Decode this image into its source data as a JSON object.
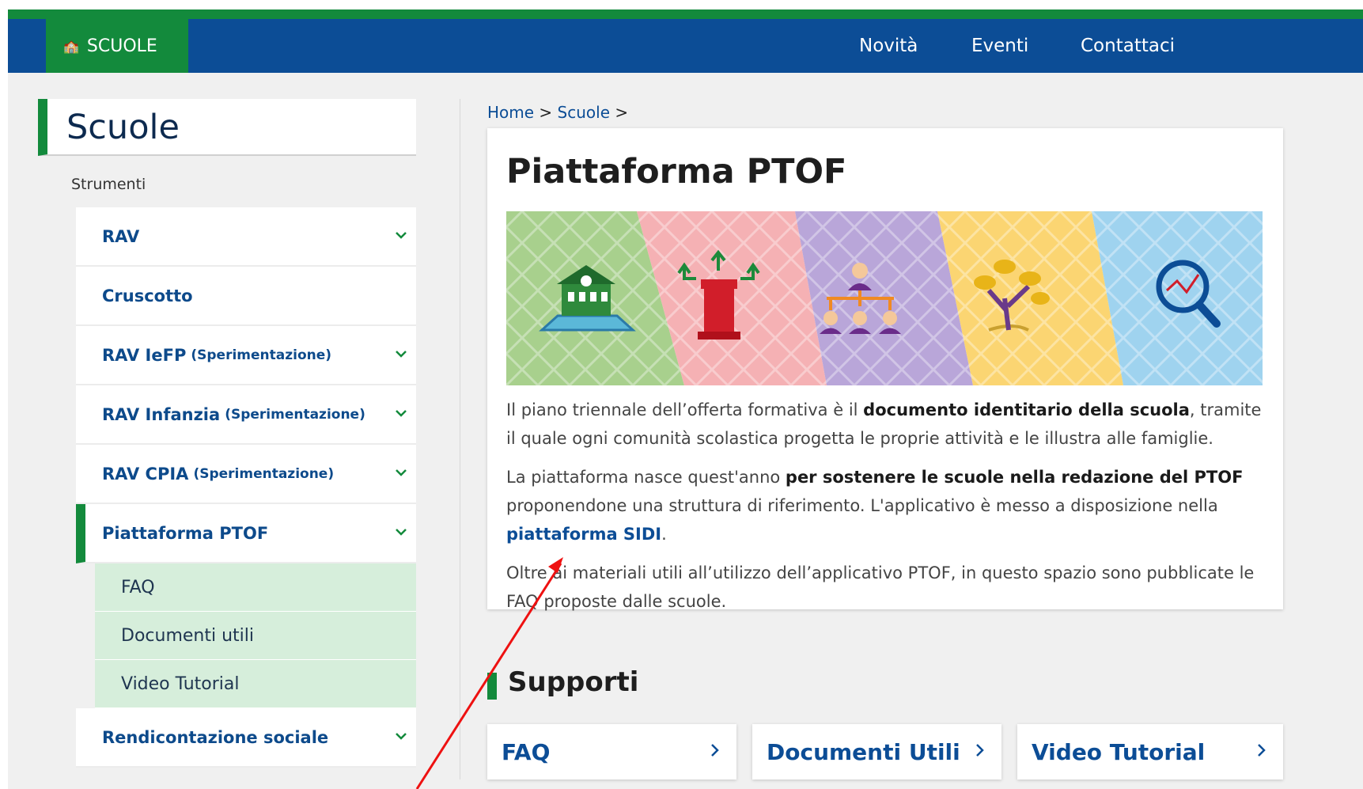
{
  "navbar": {
    "brand_label": "SCUOLE",
    "links": [
      "Novità",
      "Eventi",
      "Contattaci"
    ]
  },
  "sidebar": {
    "title": "Scuole",
    "subtitle": "Strumenti",
    "items": [
      {
        "label": "RAV",
        "note": "",
        "has_chevron": true
      },
      {
        "label": "Cruscotto",
        "note": "",
        "has_chevron": false
      },
      {
        "label": "RAV IeFP",
        "note": "(Sperimentazione)",
        "has_chevron": true
      },
      {
        "label": "RAV Infanzia",
        "note": "(Sperimentazione)",
        "has_chevron": true
      },
      {
        "label": "RAV CPIA",
        "note": "(Sperimentazione)",
        "has_chevron": true
      },
      {
        "label": "Piattaforma PTOF",
        "note": "",
        "has_chevron": true,
        "active": true
      },
      {
        "label": "Rendicontazione sociale",
        "note": "",
        "has_chevron": true
      }
    ],
    "subitems": [
      "FAQ",
      "Documenti utili",
      "Video Tutorial"
    ]
  },
  "breadcrumb": {
    "items": [
      "Home",
      "Scuole"
    ],
    "separator": ">"
  },
  "main": {
    "title": "Piattaforma PTOF",
    "p1_a": "Il piano triennale dell’offerta formativa è il ",
    "p1_b": "documento identitario della scuola",
    "p1_c": ", tramite il quale ogni comunità scolastica progetta le proprie attività e le illustra alle famiglie.",
    "p2_a": "La piattaforma nasce quest'anno ",
    "p2_b": "per sostenere le scuole nella redazione del PTOF",
    "p2_c": " proponendone una struttura di riferimento. L'applicativo è messo a disposizione nella ",
    "p2_link": "piattaforma SIDI",
    "p2_d": ".",
    "p3": "Oltre ai materiali utili all’utilizzo dell’applicativo PTOF, in questo spazio sono pubblicate le FAQ proposte dalle scuole."
  },
  "supporti": {
    "title": "Supporti",
    "cards": [
      "FAQ",
      "Documenti Utili",
      "Video Tutorial"
    ]
  },
  "colors": {
    "green": "#138a3c",
    "blue": "#0c4d96",
    "submenu_bg": "#d6eedb",
    "arrow": "#e11"
  }
}
